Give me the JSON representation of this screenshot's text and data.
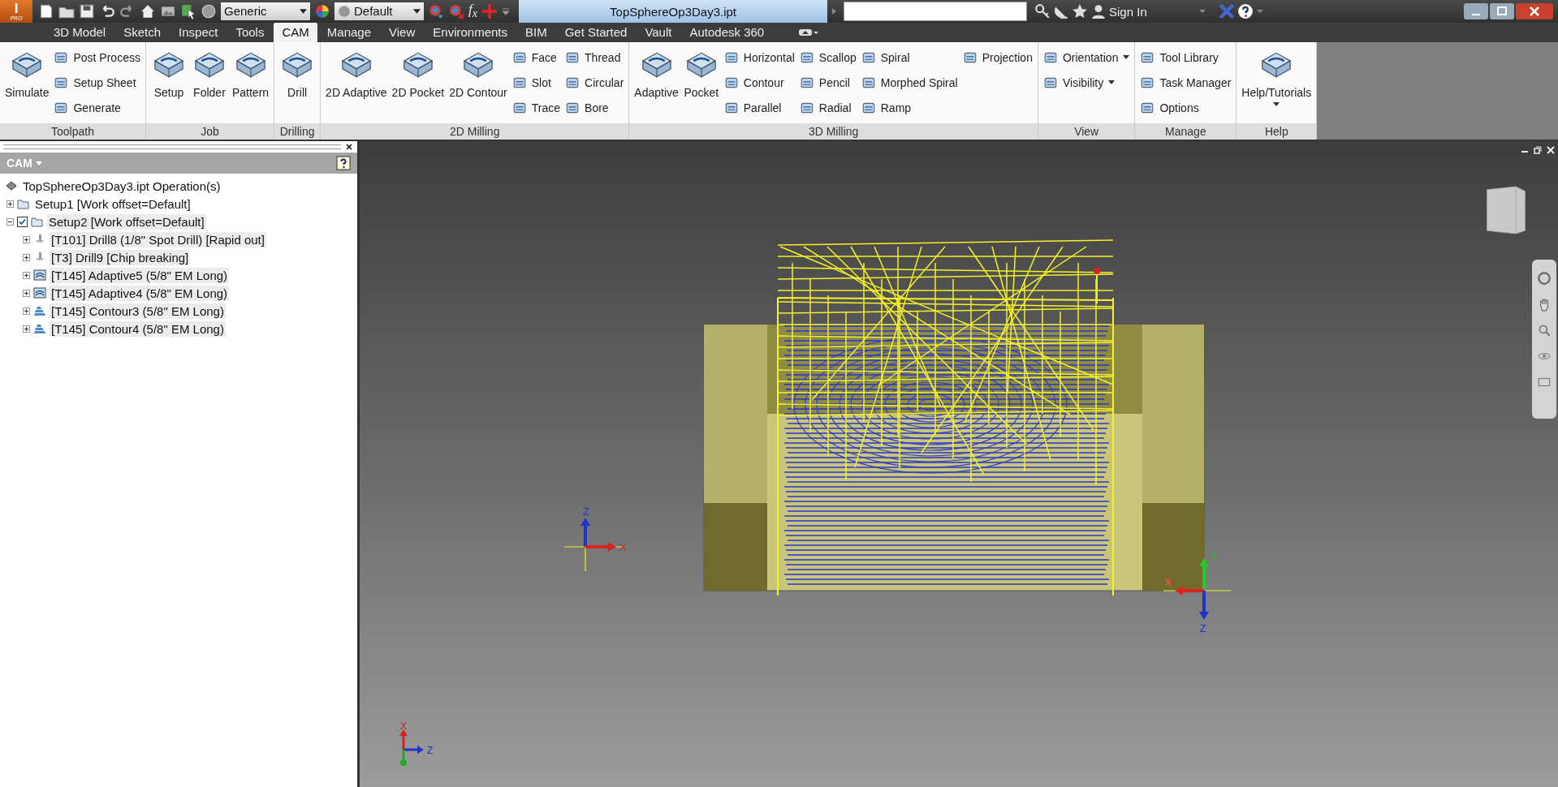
{
  "app_button": {
    "letter": "I",
    "badge": "PRO"
  },
  "quick_access": {
    "style_dropdown": "Generic",
    "appearance_dropdown": "Default",
    "formula": "f$_{x}$"
  },
  "window": {
    "title": "TopSphereOp3Day3.ipt"
  },
  "sign_in": "Sign In",
  "tabs": [
    {
      "label": "3D Model",
      "selected": false
    },
    {
      "label": "Sketch",
      "selected": false
    },
    {
      "label": "Inspect",
      "selected": false
    },
    {
      "label": "Tools",
      "selected": false
    },
    {
      "label": "CAM",
      "selected": true
    },
    {
      "label": "Manage",
      "selected": false
    },
    {
      "label": "View",
      "selected": false
    },
    {
      "label": "Environments",
      "selected": false
    },
    {
      "label": "BIM",
      "selected": false
    },
    {
      "label": "Get Started",
      "selected": false
    },
    {
      "label": "Vault",
      "selected": false
    },
    {
      "label": "Autodesk 360",
      "selected": false
    }
  ],
  "ribbon": {
    "groups": [
      {
        "label": "Toolpath",
        "large": [
          {
            "label": "Simulate",
            "dropdown": false
          }
        ],
        "columns": [
          [
            {
              "label": "Post Process",
              "dropdown": false
            },
            {
              "label": "Setup Sheet",
              "dropdown": false
            },
            {
              "label": "Generate",
              "dropdown": false
            }
          ]
        ]
      },
      {
        "label": "Job",
        "large": [
          {
            "label": "Setup",
            "dropdown": false
          },
          {
            "label": "Folder",
            "dropdown": false
          },
          {
            "label": "Pattern",
            "dropdown": false
          }
        ]
      },
      {
        "label": "Drilling",
        "large": [
          {
            "label": "Drill",
            "dropdown": false
          }
        ]
      },
      {
        "label": "2D Milling",
        "large": [
          {
            "label": "2D Adaptive",
            "dropdown": false
          },
          {
            "label": "2D Pocket",
            "dropdown": false
          },
          {
            "label": "2D Contour",
            "dropdown": false
          }
        ],
        "columns": [
          [
            {
              "label": "Face",
              "dropdown": false
            },
            {
              "label": "Slot",
              "dropdown": false
            },
            {
              "label": "Trace",
              "dropdown": false
            }
          ],
          [
            {
              "label": "Thread",
              "dropdown": false
            },
            {
              "label": "Circular",
              "dropdown": false
            },
            {
              "label": "Bore",
              "dropdown": false
            }
          ]
        ]
      },
      {
        "label": "3D Milling",
        "large": [
          {
            "label": "Adaptive",
            "dropdown": false
          },
          {
            "label": "Pocket",
            "dropdown": false
          }
        ],
        "columns": [
          [
            {
              "label": "Horizontal",
              "dropdown": false
            },
            {
              "label": "Contour",
              "dropdown": false
            },
            {
              "label": "Parallel",
              "dropdown": false
            }
          ],
          [
            {
              "label": "Scallop",
              "dropdown": false
            },
            {
              "label": "Pencil",
              "dropdown": false
            },
            {
              "label": "Radial",
              "dropdown": false
            }
          ],
          [
            {
              "label": "Spiral",
              "dropdown": false
            },
            {
              "label": "Morphed Spiral",
              "dropdown": false
            },
            {
              "label": "Ramp",
              "dropdown": false
            }
          ],
          [
            {
              "label": "Projection",
              "dropdown": false
            }
          ]
        ]
      },
      {
        "label": "View",
        "columns": [
          [
            {
              "label": "Orientation",
              "dropdown": true
            },
            {
              "label": "Visibility",
              "dropdown": true
            }
          ]
        ]
      },
      {
        "label": "Manage",
        "columns": [
          [
            {
              "label": "Tool Library",
              "dropdown": false
            },
            {
              "label": "Task Manager",
              "dropdown": false
            },
            {
              "label": "Options",
              "dropdown": false
            }
          ]
        ]
      },
      {
        "label": "Help",
        "large": [
          {
            "label": "Help/Tutorials",
            "dropdown": true
          }
        ]
      }
    ]
  },
  "browser": {
    "title": "CAM",
    "root": "TopSphereOp3Day3.ipt Operation(s)",
    "setups": [
      {
        "label": "Setup1 [Work offset=Default]",
        "expanded": false
      },
      {
        "label": "Setup2 [Work offset=Default]",
        "expanded": true,
        "checked": true,
        "children": [
          {
            "label": "[T101] Drill8 (1/8\" Spot Drill) [Rapid out]",
            "kind": "drill",
            "expanded": false
          },
          {
            "label": "[T3] Drill9 [Chip breaking]",
            "kind": "drill",
            "expanded": false
          },
          {
            "label": "[T145] Adaptive5 (5/8\" EM Long)",
            "kind": "adaptive",
            "expanded": false
          },
          {
            "label": "[T145] Adaptive4 (5/8\" EM Long)",
            "kind": "adaptive",
            "expanded": false
          },
          {
            "label": "[T145] Contour3 (5/8\" EM Long)",
            "kind": "contour",
            "expanded": false
          },
          {
            "label": "[T145] Contour4 (5/8\" EM Long)",
            "kind": "contour",
            "expanded": false
          }
        ]
      }
    ]
  },
  "viewport": {
    "model_triad": {
      "z": "Z",
      "x": "X"
    },
    "part_triad": {
      "y": "Y",
      "x": "X",
      "z": "Z"
    },
    "corner_triad": {
      "x": "X",
      "z": "Z"
    }
  }
}
